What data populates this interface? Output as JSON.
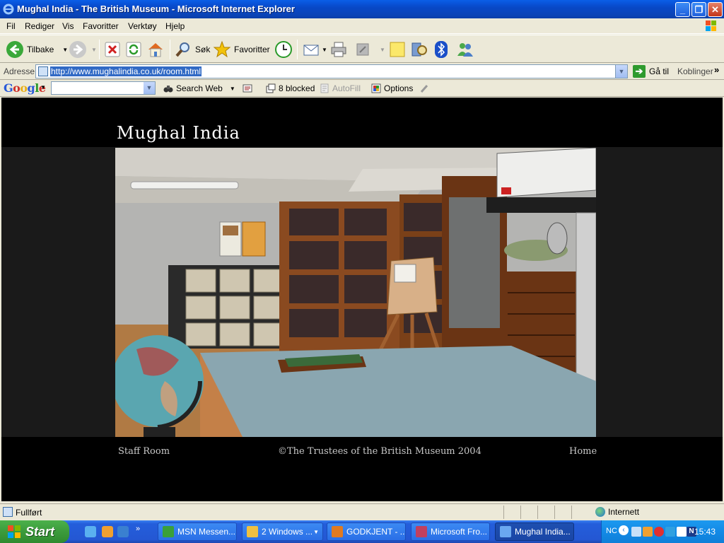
{
  "window": {
    "title": "Mughal India - The British Museum - Microsoft Internet Explorer"
  },
  "menubar": {
    "items": [
      "Fil",
      "Rediger",
      "Vis",
      "Favoritter",
      "Verktøy",
      "Hjelp"
    ]
  },
  "toolbar": {
    "back_label": "Tilbake",
    "search_label": "Søk",
    "favorites_label": "Favoritter"
  },
  "addressbar": {
    "label": "Adresse",
    "url": "http://www.mughalindia.co.uk/room.html",
    "go_label": "Gå til",
    "links_label": "Koblinger"
  },
  "googlebar": {
    "logo": "Google",
    "search_value": "",
    "search_web_label": "Search Web",
    "blocked_label": "8 blocked",
    "autofill_label": "AutoFill",
    "options_label": "Options"
  },
  "page": {
    "site_title": "Mughal India",
    "footer_left": "Staff Room",
    "footer_center": "©The Trustees of the British Museum 2004",
    "footer_right": "Home"
  },
  "statusbar": {
    "text": "Fullført",
    "zone": "Internett"
  },
  "taskbar": {
    "start_label": "Start",
    "tasks": [
      {
        "label": "MSN Messen...",
        "color": "#3aa03a"
      },
      {
        "label": "2 Windows ...",
        "color": "#f0c040"
      },
      {
        "label": "GODKJENT - ...",
        "color": "#e07a20"
      },
      {
        "label": "Microsoft Fro...",
        "color": "#c04060"
      },
      {
        "label": "Mughal India...",
        "color": "#6aa8f0"
      }
    ],
    "tray_text": "NC",
    "clock": "15:43"
  }
}
